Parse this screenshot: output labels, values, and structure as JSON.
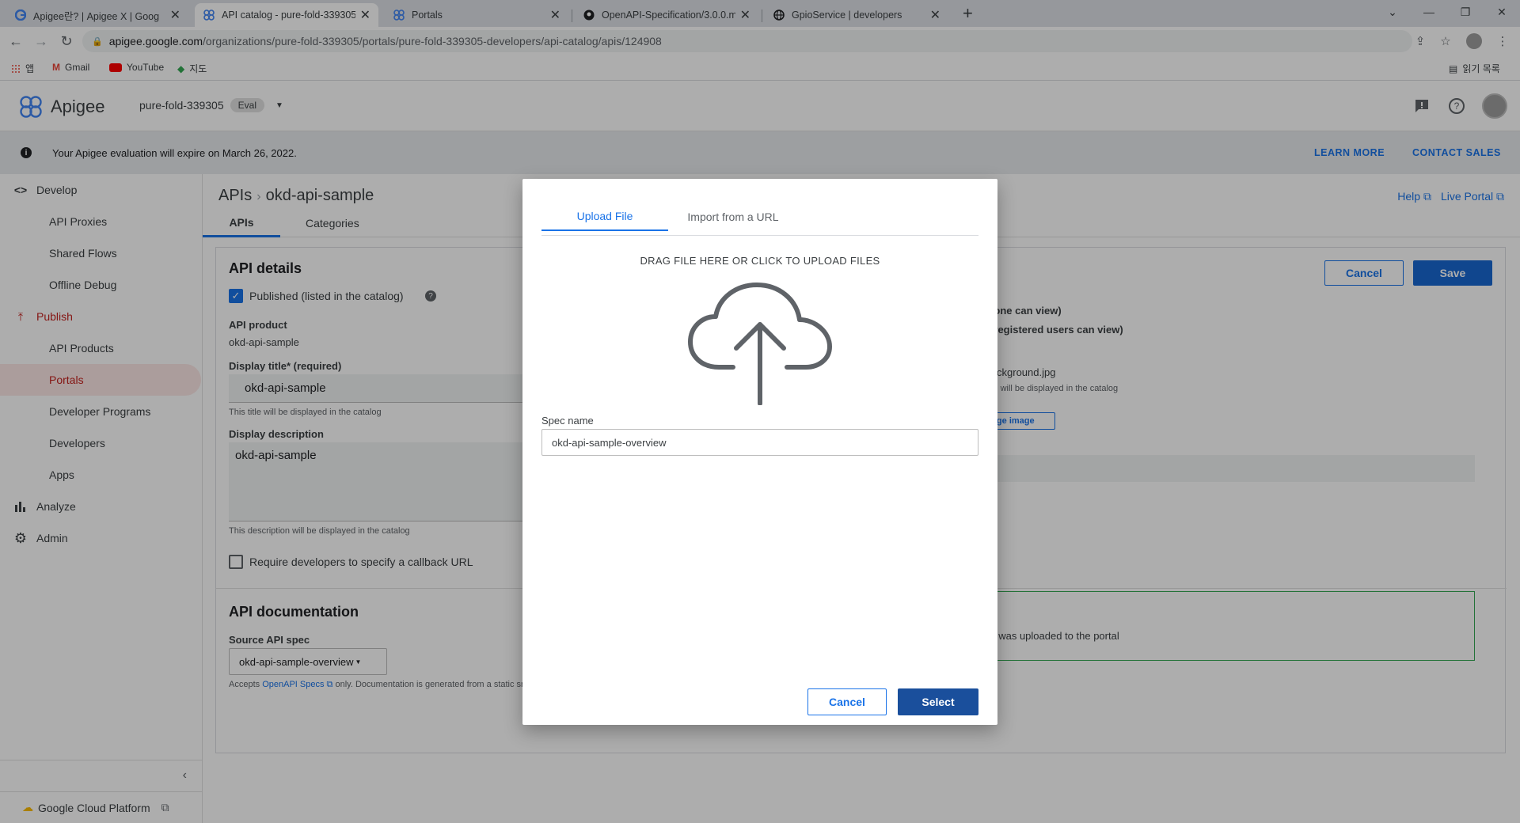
{
  "browser": {
    "tabs": [
      {
        "title": "Apigee란? | Apigee X | Goog"
      },
      {
        "title": "API catalog - pure-fold-339305"
      },
      {
        "title": "Portals"
      },
      {
        "title": "OpenAPI-Specification/3.0.0.md"
      },
      {
        "title": "GpioService | developers"
      }
    ],
    "url_domain": "apigee.google.com",
    "url_path": "/organizations/pure-fold-339305/portals/pure-fold-339305-developers/api-catalog/apis/124908",
    "bookmarks": [
      {
        "label": "앱"
      },
      {
        "label": "Gmail"
      },
      {
        "label": "YouTube"
      },
      {
        "label": "지도"
      }
    ],
    "reading_list": "읽기 목록"
  },
  "header": {
    "app_name": "Apigee",
    "org": "pure-fold-339305",
    "badge": "Eval"
  },
  "banner": {
    "message": "Your Apigee evaluation will expire on March 26, 2022.",
    "learn_more": "LEARN MORE",
    "contact_sales": "CONTACT SALES"
  },
  "sidebar": {
    "items": [
      {
        "label": "Develop",
        "kind": "top",
        "icon": "code-icon"
      },
      {
        "label": "API Proxies",
        "kind": "sub"
      },
      {
        "label": "Shared Flows",
        "kind": "sub"
      },
      {
        "label": "Offline Debug",
        "kind": "sub"
      },
      {
        "label": "Publish",
        "kind": "top",
        "icon": "publish-icon"
      },
      {
        "label": "API Products",
        "kind": "sub"
      },
      {
        "label": "Portals",
        "kind": "sub",
        "active": true
      },
      {
        "label": "Developer Programs",
        "kind": "sub"
      },
      {
        "label": "Developers",
        "kind": "sub"
      },
      {
        "label": "Apps",
        "kind": "sub"
      },
      {
        "label": "Analyze",
        "kind": "top",
        "icon": "bar-chart-icon"
      },
      {
        "label": "Admin",
        "kind": "top",
        "icon": "gear-icon"
      }
    ],
    "footer": "Google Cloud Platform"
  },
  "main": {
    "crumb_root": "APIs",
    "crumb_leaf": "okd-api-sample",
    "help": "Help",
    "live_portal": "Live Portal",
    "tabs": [
      "APIs",
      "Categories"
    ],
    "details_title": "API details",
    "published_label": "Published (listed in the catalog)",
    "api_product_label": "API product",
    "api_product_value": "okd-api-sample",
    "display_title_label": "Display title* (required)",
    "display_title_value": "okd-api-sample",
    "display_title_hint": "This title will be displayed in the catalog",
    "display_desc_label": "Display description",
    "display_desc_value": "okd-api-sample",
    "display_desc_hint": "This description will be displayed in the catalog",
    "callback_label": "Require developers to specify a callback URL",
    "doc_title": "API documentation",
    "source_spec_label": "Source API spec",
    "source_spec_value": "okd-api-sample-overview",
    "accepts_prefix": "Accepts",
    "accepts_link": "OpenAPI Specs",
    "accepts_suffix": "only. Documentation is generated from a static snapshot of the selected spec.",
    "cancel": "Cancel",
    "save": "Save",
    "audience_public": "anyone can view)",
    "audience_registered": "nly registered users can view)",
    "image_name": "e-background.jpg",
    "image_hint": "mage will be displayed in the catalog",
    "change_image": "hange image",
    "uploaded_note": "t was uploaded to the portal"
  },
  "modal": {
    "tab_upload": "Upload File",
    "tab_import": "Import from a URL",
    "drop_text": "DRAG FILE HERE OR CLICK TO UPLOAD FILES",
    "spec_name_label": "Spec name",
    "spec_name_value": "okd-api-sample-overview",
    "cancel": "Cancel",
    "select": "Select"
  },
  "colors": {
    "accent": "#1a73e8",
    "primary_button": "#1967d2",
    "active_nav": "#c5221f"
  }
}
